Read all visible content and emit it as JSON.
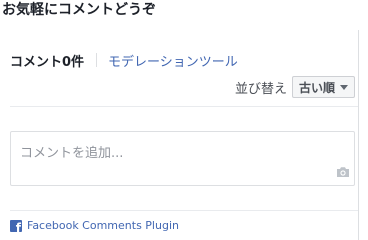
{
  "title": "お気軽にコメントどうぞ",
  "comments": {
    "count_label": "コメント0件",
    "moderation_link": "モデレーションツール",
    "sort_label": "並び替え",
    "sort_selected": "古い順",
    "input_placeholder": "コメントを追加...",
    "camera_icon": "camera-icon"
  },
  "footer": {
    "icon": "facebook-icon",
    "icon_glyph": "f",
    "link_text": "Facebook Comments Plugin"
  },
  "colors": {
    "link": "#4267b2",
    "text": "#1d2129",
    "placeholder": "#90949c",
    "border": "#dddfe2"
  }
}
